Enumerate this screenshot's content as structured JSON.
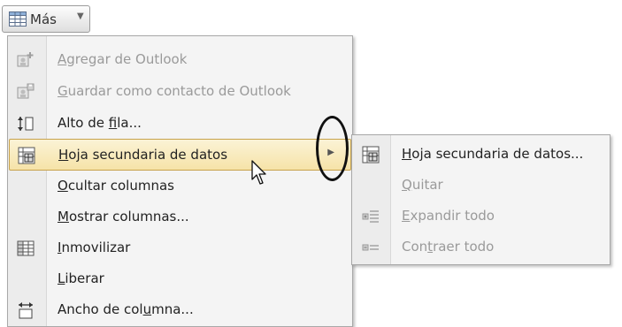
{
  "toolbar": {
    "mas_label": "Más",
    "mas_icon": "table-grid-icon",
    "dropdown_icon": "chevron-down-icon"
  },
  "menu": {
    "items": [
      {
        "pre": "",
        "u": "A",
        "post": "gregar de Outlook",
        "icon": "add-contact-icon",
        "enabled": false
      },
      {
        "pre": "",
        "u": "G",
        "post": "uardar como contacto de Outlook",
        "icon": "save-contact-icon",
        "enabled": false
      },
      {
        "pre": "Alto de ",
        "u": "f",
        "post": "ila...",
        "icon": "row-height-icon",
        "enabled": true
      },
      {
        "pre": "",
        "u": "H",
        "post": "oja secundaria de datos",
        "icon": "subdatasheet-icon",
        "enabled": true,
        "submenu": true
      },
      {
        "pre": "",
        "u": "O",
        "post": "cultar columnas",
        "icon": "",
        "enabled": true
      },
      {
        "pre": "",
        "u": "M",
        "post": "ostrar columnas...",
        "icon": "",
        "enabled": true
      },
      {
        "pre": "",
        "u": "I",
        "post": "nmovilizar",
        "icon": "freeze-icon",
        "enabled": true
      },
      {
        "pre": "",
        "u": "L",
        "post": "iberar",
        "icon": "",
        "enabled": true
      },
      {
        "pre": "Ancho de col",
        "u": "u",
        "post": "mna...",
        "icon": "column-width-icon",
        "enabled": true
      }
    ]
  },
  "submenu": {
    "items": [
      {
        "pre": "",
        "u": "H",
        "post": "oja secundaria de datos...",
        "icon": "subdatasheet-icon",
        "enabled": true
      },
      {
        "pre": "",
        "u": "Q",
        "post": "uitar",
        "icon": "",
        "enabled": false
      },
      {
        "pre": "",
        "u": "E",
        "post": "xpandir todo",
        "icon": "expand-all-icon",
        "enabled": false
      },
      {
        "pre": "Con",
        "u": "t",
        "post": "raer todo",
        "icon": "collapse-all-icon",
        "enabled": false
      }
    ]
  },
  "colors": {
    "highlight_bg": "#f6e3a8",
    "highlight_border": "#c7a24c",
    "disabled_text": "#9a9a9a"
  }
}
